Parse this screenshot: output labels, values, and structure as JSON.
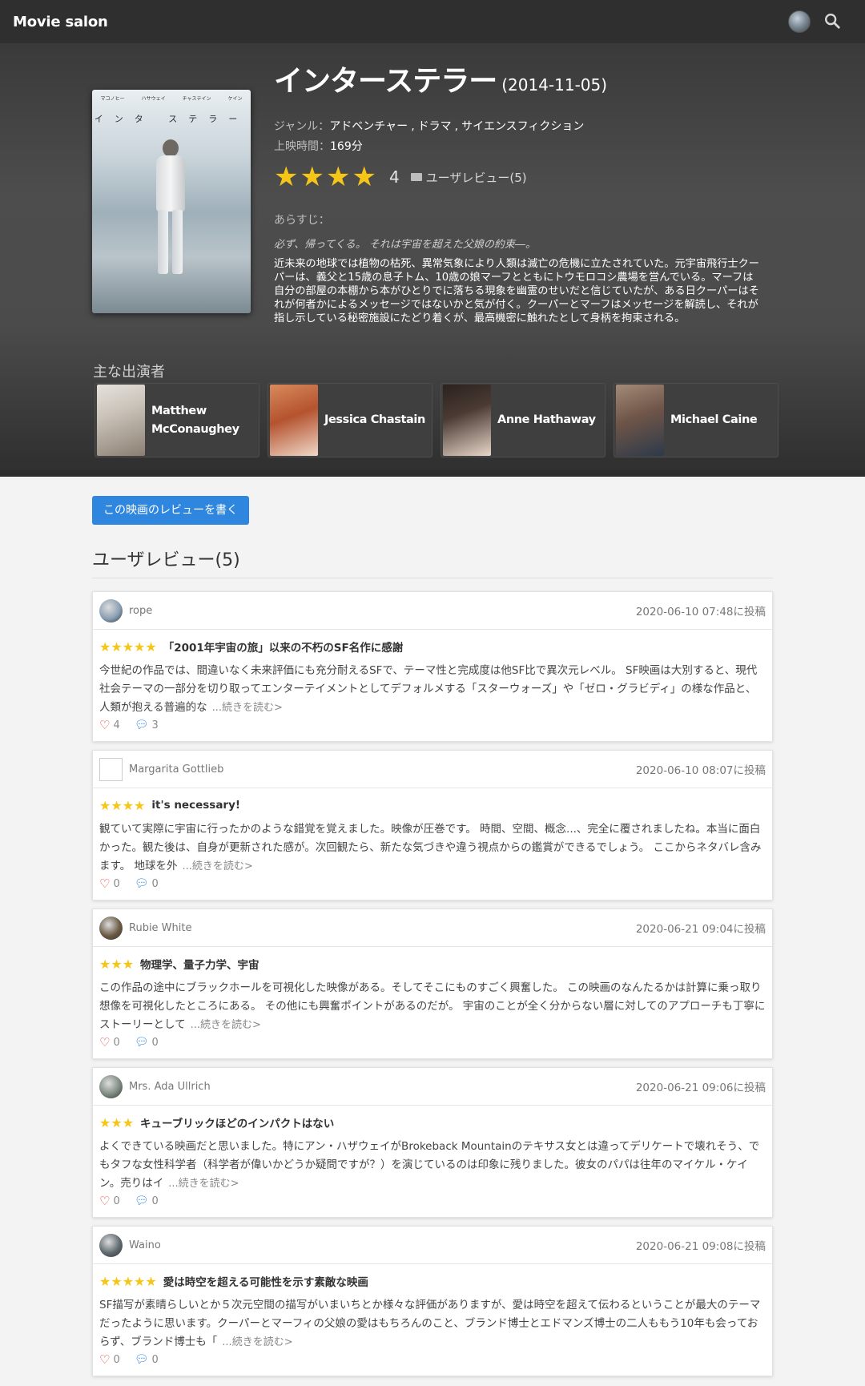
{
  "navbar": {
    "brand": "Movie salon"
  },
  "movie": {
    "title": "インターステラー",
    "release_date": "(2014-11-05)",
    "poster_title": "インタ ステラー",
    "poster_credits": [
      "マコノヒー",
      "ハサウェイ",
      "チャステイン",
      "ケイン"
    ],
    "genre_label": "ジャンル：",
    "genres": [
      "アドベンチャー",
      "ドラマ",
      "サイエンスフィクション"
    ],
    "runtime_label": "上映時間：",
    "runtime": "169分",
    "rating_value": "4",
    "rating_stars": 4,
    "review_link": "ユーザレビュー(5)",
    "synopsis_label": "あらすじ：",
    "tagline": "必ず、帰ってくる。 それは宇宙を超えた父娘の約束―。",
    "synopsis": "近未来の地球では植物の枯死、異常気象により人類は滅亡の危機に立たされていた。元宇宙飛行士クーパーは、義父と15歳の息子トム、10歳の娘マーフとともにトウモロコシ農場を営んでいる。マーフは自分の部屋の本棚から本がひとりでに落ちる現象を幽霊のせいだと信じていたが、ある日クーパーはそれが何者かによるメッセージではないかと気が付く。クーパーとマーフはメッセージを解読し、それが指し示している秘密施設にたどり着くが、最高機密に触れたとして身柄を拘束される。"
  },
  "cast": {
    "heading": "主な出演者",
    "members": [
      {
        "name_line1": "Matthew",
        "name_line2": "McConaughey",
        "color": "#cfc9c2"
      },
      {
        "name_line1": "Jessica Chastain",
        "name_line2": "",
        "color": "#b46a4a"
      },
      {
        "name_line1": "Anne Hathaway",
        "name_line2": "",
        "color": "#3a2e2a"
      },
      {
        "name_line1": "Michael Caine",
        "name_line2": "",
        "color": "#7a5f52"
      }
    ]
  },
  "main": {
    "write_button": "この映画のレビューを書く",
    "reviews_heading": "ユーザレビュー(5)",
    "read_more": "...続きを読む>"
  },
  "reviews": [
    {
      "user": "rope",
      "date": "2020-06-10 07:48に投稿",
      "stars": 5,
      "title": "「2001年宇宙の旅」以来の不朽のSF名作に感謝",
      "text": "今世紀の作品では、間違いなく未来評価にも充分耐えるSFで、テーマ性と完成度は他SF比で異次元レベル。 SF映画は大別すると、現代社会テーマの一部分を切り取ってエンターテイメントとしてデフォルメする「スターウォーズ」や「ゼロ・グラビディ」の様な作品と、人類が抱える普遍的な",
      "likes": "4",
      "comments": "3",
      "avatar_color": "#8aa0b4"
    },
    {
      "user": "Margarita Gottlieb",
      "date": "2020-06-10 08:07に投稿",
      "stars": 4,
      "title": "it's necessary!",
      "text": "観ていて実際に宇宙に行ったかのような錯覚を覚えました。映像が圧巻です。 時間、空間、概念...、完全に覆されましたね。本当に面白かった。観た後は、自身が更新された感が。次回観たら、新たな気づきや違う視点からの鑑賞ができるでしょう。 ここからネタバレ含みます。 地球を外",
      "likes": "0",
      "comments": "0",
      "avatar_color": "#ffffff"
    },
    {
      "user": "Rubie White",
      "date": "2020-06-21 09:04に投稿",
      "stars": 3,
      "title": "物理学、量子力学、宇宙",
      "text": "この作品の途中にブラックホールを可視化した映像がある。そしてそこにものすごく興奮した。 この映画のなんたるかは計算に乗っ取り想像を可視化したところにある。 その他にも興奮ポイントがあるのだが。 宇宙のことが全く分からない層に対してのアプローチも丁寧にストーリーとして",
      "likes": "0",
      "comments": "0",
      "avatar_color": "#6b5a44"
    },
    {
      "user": "Mrs. Ada Ullrich",
      "date": "2020-06-21 09:06に投稿",
      "stars": 3,
      "title": "キューブリックほどのインパクトはない",
      "text": "よくできている映画だと思いました。特にアン・ハザウェイがBrokeback Mountainのテキサス女とは違ってデリケートで壊れそう、でもタフな女性科学者（科学者が偉いかどうか疑問ですが？）を演じているのは印象に残りました。彼女のパパは往年のマイケル・ケイン。売りはイ",
      "likes": "0",
      "comments": "0",
      "avatar_color": "#7d8a80"
    },
    {
      "user": "Waino",
      "date": "2020-06-21 09:08に投稿",
      "stars": 5,
      "title": "愛は時空を超える可能性を示す素敵な映画",
      "text": "SF描写が素晴らしいとか５次元空間の描写がいまいちとか様々な評価がありますが、愛は時空を超えて伝わるということが最大のテーマだったように思います。クーパーとマーフィの父娘の愛はもちろんのこと、ブランド博士とエドマンズ博士の二人ももう10年も会っておらず、ブランド博士も「",
      "likes": "0",
      "comments": "0",
      "avatar_color": "#5f6a70"
    }
  ],
  "colors": {
    "accent": "#2e86de",
    "star": "#f5c518",
    "heart": "#e53935",
    "navbar": "#2f2f2f"
  }
}
